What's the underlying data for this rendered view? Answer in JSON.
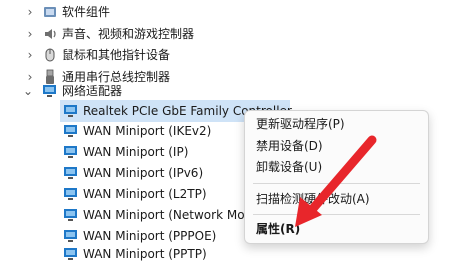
{
  "tree": {
    "categories": [
      {
        "label": "软件组件",
        "icon": "software-component-icon"
      },
      {
        "label": "声音、视频和游戏控制器",
        "icon": "speaker-icon"
      },
      {
        "label": "鼠标和其他指针设备",
        "icon": "mouse-icon"
      },
      {
        "label": "通用串行总线控制器",
        "icon": "usb-icon"
      },
      {
        "label": "网络适配器",
        "icon": "network-adapter-icon"
      }
    ],
    "adapters": [
      {
        "label": "Realtek PCIe GbE Family Controller"
      },
      {
        "label": "WAN Miniport (IKEv2)"
      },
      {
        "label": "WAN Miniport (IP)"
      },
      {
        "label": "WAN Miniport (IPv6)"
      },
      {
        "label": "WAN Miniport (L2TP)"
      },
      {
        "label": "WAN Miniport (Network Monitor)"
      },
      {
        "label": "WAN Miniport (PPPOE)"
      },
      {
        "label": "WAN Miniport (PPTP)"
      }
    ]
  },
  "context_menu": {
    "update_driver": "更新驱动程序(P)",
    "disable_device": "禁用设备(D)",
    "uninstall_device": "卸载设备(U)",
    "scan_hardware": "扫描检测硬件改动(A)",
    "properties": "属性(R)"
  },
  "colors": {
    "selection": "#cfe3f7",
    "arrow": "#e8262b",
    "monitor": "#1e78c8"
  }
}
